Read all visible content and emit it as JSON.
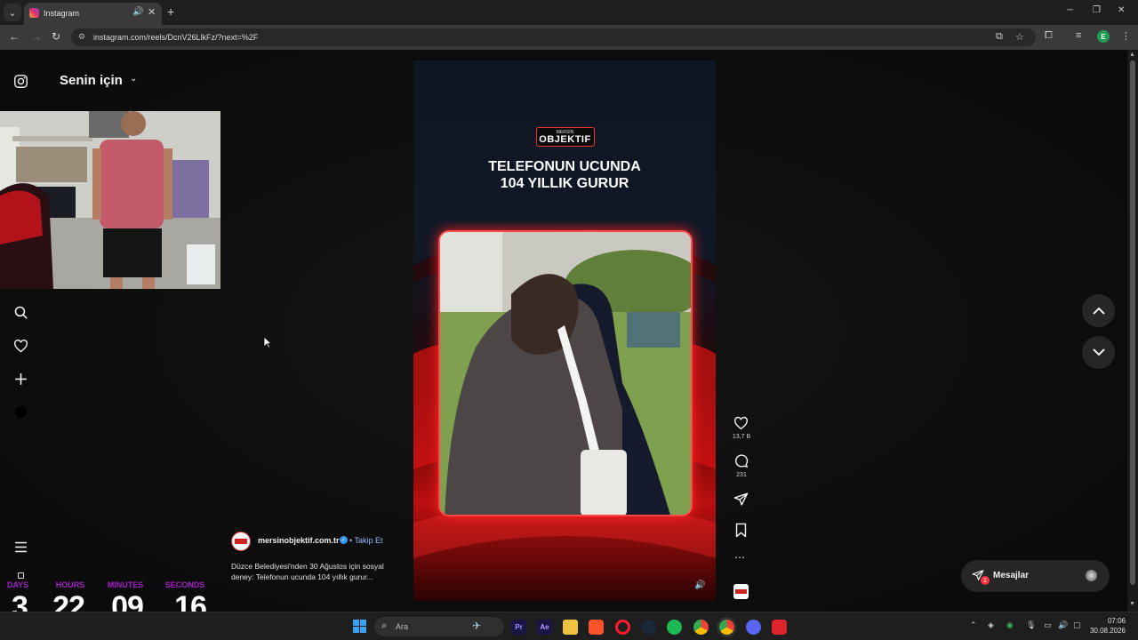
{
  "browser": {
    "tab": {
      "title": "Instagram"
    },
    "url": "instagram.com/reels/DcnV26LlkFz/?next=%2F",
    "profile_initial": "E"
  },
  "sidebar": {
    "feed_title": "Senin için"
  },
  "reel": {
    "logo_small": "MERSİN",
    "logo_main": "OBJEKTIF",
    "headline_line1": "TELEFONUN UCUNDA",
    "headline_line2": "104 YILLIK GURUR",
    "likes": "13,7 B",
    "comments": "231"
  },
  "post": {
    "author": "mersinobjektif.com.tr",
    "separator": "•",
    "follow_label": "Takip Et",
    "caption": "Düzce Belediyesi'nden 30 Ağustos için sosyal deney: Telefonun ucunda 104 yıllık gurur..."
  },
  "messages": {
    "label": "Mesajlar",
    "badge": "1"
  },
  "countdown": {
    "days_label": "DAYS",
    "hours_label": "HOURS",
    "minutes_label": "MINUTES",
    "seconds_label": "SECONDS",
    "days": "3",
    "hours": "22",
    "minutes": "09",
    "seconds": "16"
  },
  "taskbar": {
    "search_placeholder": "Ara",
    "app_pr": "Pr",
    "app_ae": "Ae",
    "time": "07:06",
    "date": "30.08.2026"
  },
  "colors": {
    "accent_red": "#e8141b",
    "countdown_label": "#a21fc6",
    "verified_blue": "#3897f0"
  }
}
